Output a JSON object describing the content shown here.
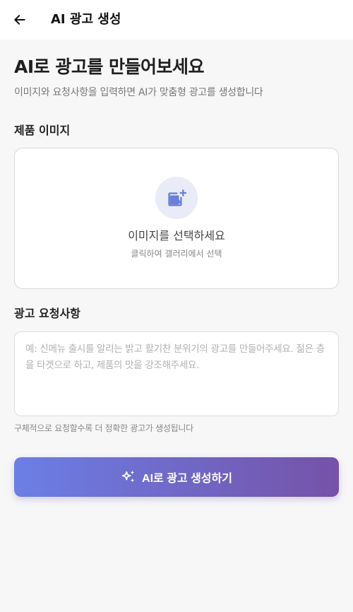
{
  "header": {
    "title": "AI 광고 생성",
    "back_icon": "arrow-left-icon"
  },
  "hero": {
    "title": "AI로 광고를 만들어보세요",
    "subtitle": "이미지와 요청사항을 입력하면 AI가 맞춤형 광고를 생성합니다"
  },
  "image_section": {
    "label": "제품 이미지",
    "upload_icon": "add-photo-icon",
    "upload_title": "이미지를 선택하세요",
    "upload_subtitle": "클릭하여 갤러리에서 선택"
  },
  "request_section": {
    "label": "광고 요청사항",
    "value": "",
    "placeholder": "예: 신메뉴 출시를 알리는 밝고 활기찬 분위기의 광고를 만들어주세요. 젊은 층을 타겟으로 하고, 제품의 맛을 강조해주세요.",
    "hint": "구체적으로 요청할수록 더 정확한 광고가 생성됩니다"
  },
  "generate_button": {
    "label": "AI로 광고 생성하기",
    "icon": "sparkles-icon"
  },
  "colors": {
    "accent_start": "#6b7fe6",
    "accent_end": "#7552a8",
    "icon_accent": "#6a7fd8",
    "background": "#f7f7f8"
  }
}
